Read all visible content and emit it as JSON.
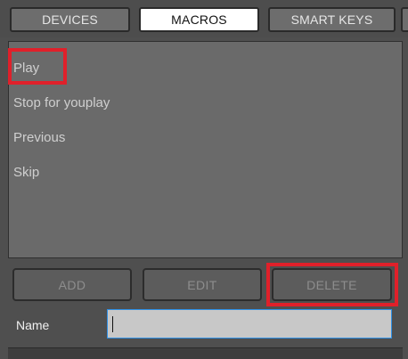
{
  "tabs": [
    {
      "label": "DEVICES",
      "active": false
    },
    {
      "label": "MACROS",
      "active": true
    },
    {
      "label": "SMART KEYS",
      "active": false
    }
  ],
  "macros": [
    {
      "label": "Play",
      "highlighted": true
    },
    {
      "label": "Stop for youplay",
      "highlighted": false
    },
    {
      "label": "Previous",
      "highlighted": false
    },
    {
      "label": "Skip",
      "highlighted": false
    }
  ],
  "buttons": {
    "add": "ADD",
    "edit": "EDIT",
    "delete": "DELETE"
  },
  "name_field": {
    "label": "Name",
    "value": ""
  },
  "colors": {
    "highlight": "#e0202a",
    "focus_border": "#2d8fe5"
  }
}
